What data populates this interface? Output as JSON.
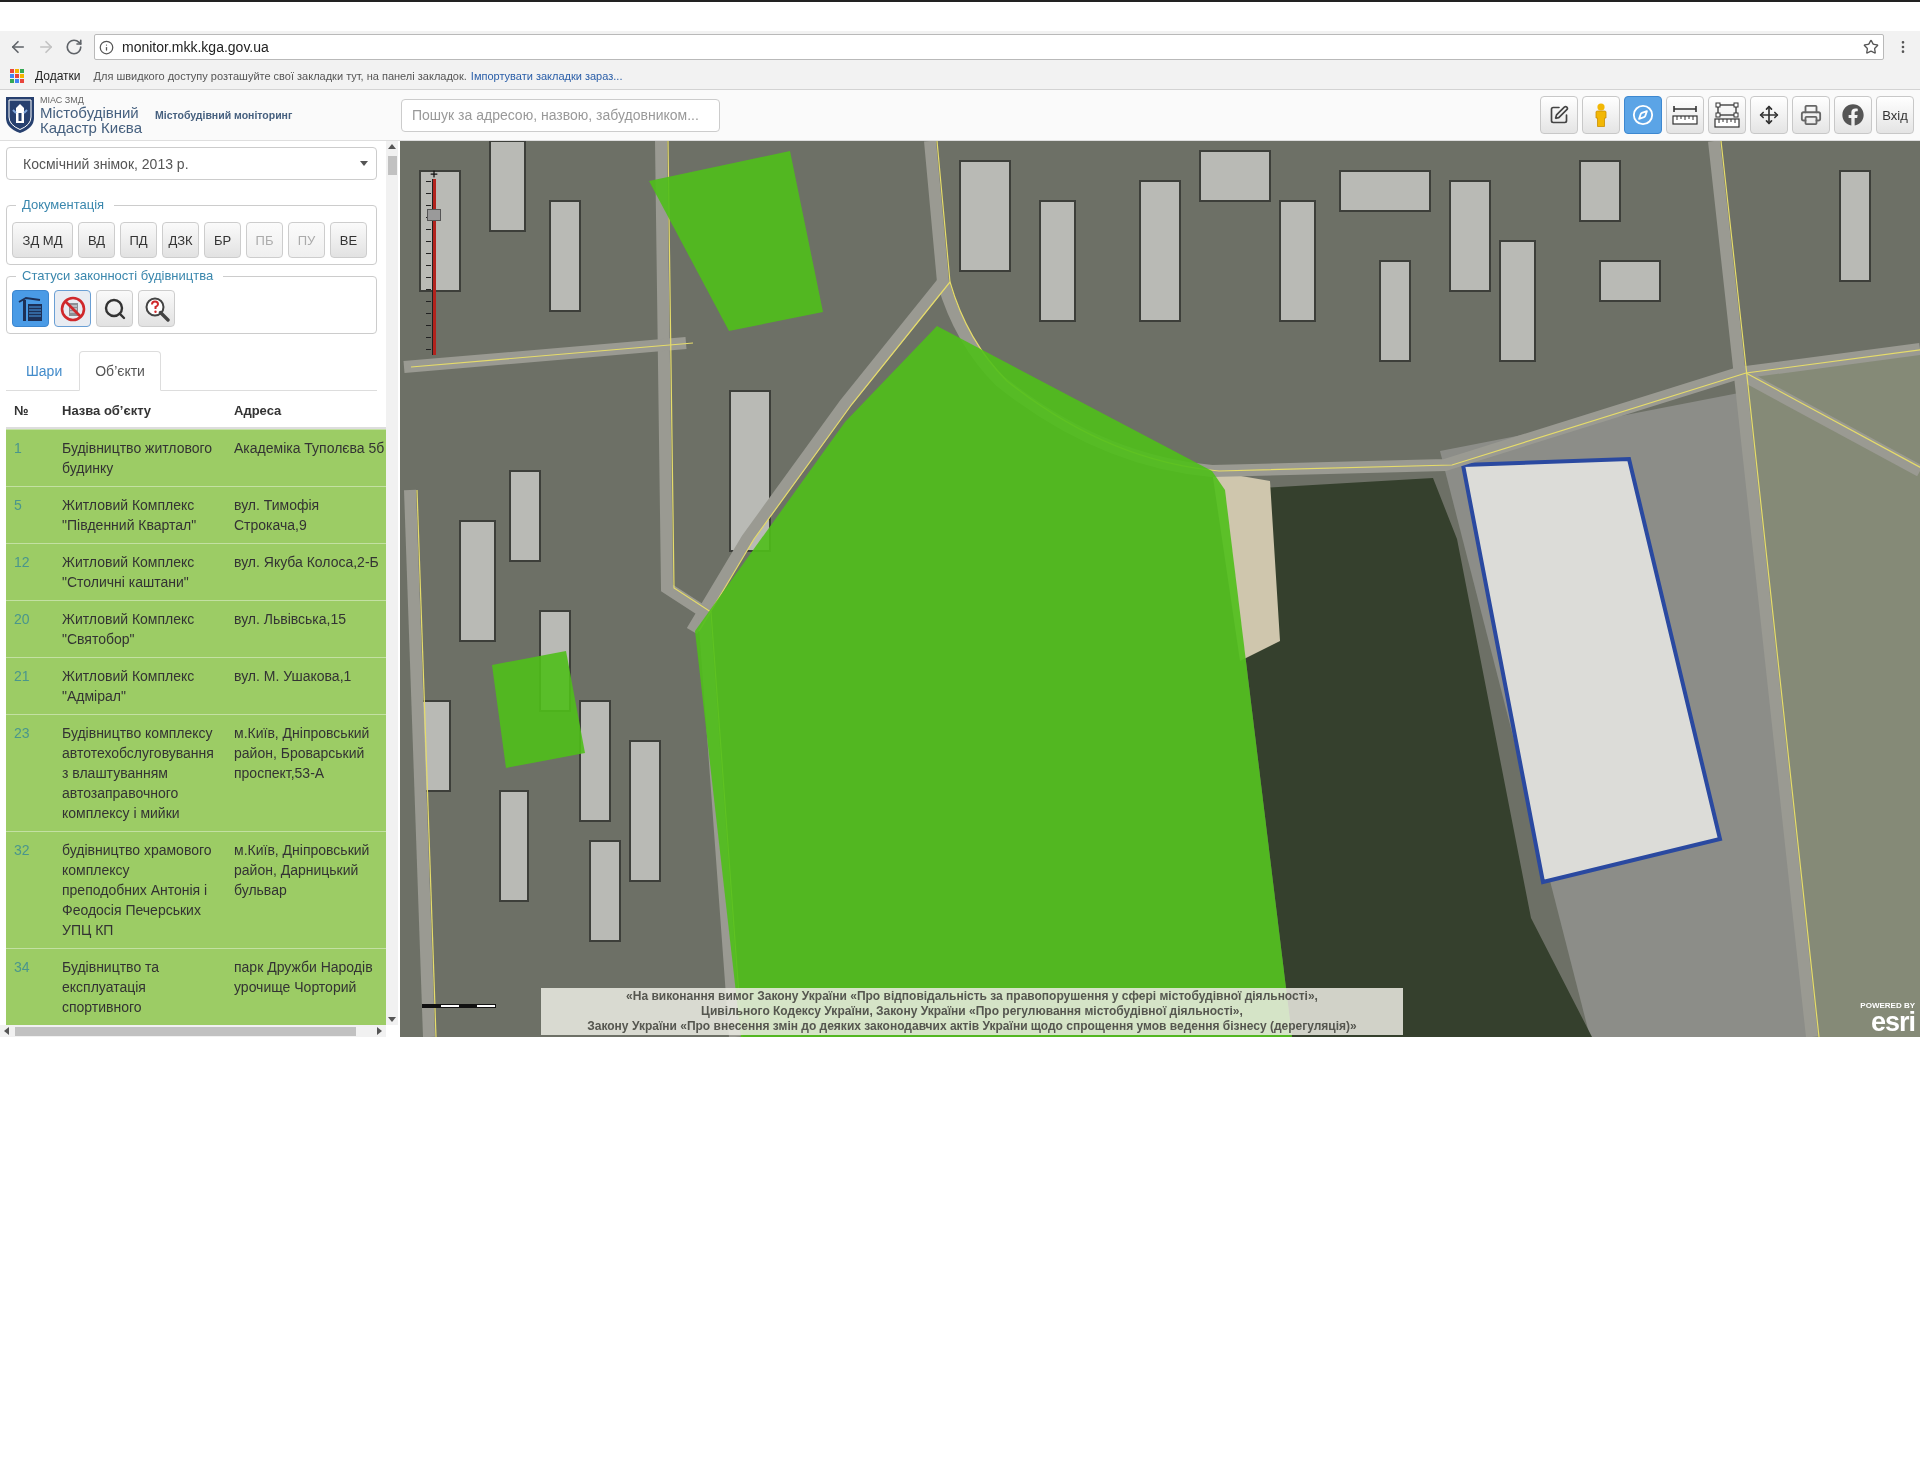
{
  "browser": {
    "nav": [
      {
        "kind": "back",
        "disabled": false
      },
      {
        "kind": "forward",
        "disabled": true
      },
      {
        "kind": "reload",
        "disabled": false
      }
    ],
    "url": "monitor.mkk.kga.gov.ua",
    "bookmarks": {
      "apps_label": "Додатки",
      "hint": "Для швидкого доступу розташуйте свої закладки тут, на панелі закладок.",
      "import_link": "Імпортувати закладки зараз..."
    }
  },
  "header": {
    "logo": {
      "caption": "МІАС ЗМД",
      "title_line_1": "Містобудівний",
      "title_line_2": "Кадастр Києва"
    },
    "subtitle": "Містобудівний моніторинг",
    "search": {
      "placeholder": "Пошук за адресою, назвою, забудовником..."
    },
    "toolbar": [
      {
        "kind": "edit",
        "selected": false
      },
      {
        "kind": "pegman",
        "selected": false
      },
      {
        "kind": "compass",
        "selected": true
      },
      {
        "kind": "ruler",
        "selected": false
      },
      {
        "kind": "area",
        "selected": false
      },
      {
        "kind": "move",
        "selected": false
      },
      {
        "kind": "print",
        "selected": false
      },
      {
        "kind": "facebook",
        "selected": false
      },
      {
        "kind": "login",
        "label": "Вхід",
        "selected": false
      }
    ]
  },
  "sidebar": {
    "basemap_select": {
      "value": "Космічний знімок, 2013 р."
    },
    "documentation": {
      "legend": "Документація",
      "buttons": [
        {
          "label": "ЗД МД",
          "disabled": false
        },
        {
          "label": "ВД",
          "disabled": false
        },
        {
          "label": "ПД",
          "disabled": false
        },
        {
          "label": "ДЗК",
          "disabled": false
        },
        {
          "label": "БР",
          "disabled": false
        },
        {
          "label": "ПБ",
          "disabled": true
        },
        {
          "label": "ПУ",
          "disabled": true
        },
        {
          "label": "ВЕ",
          "disabled": false
        }
      ]
    },
    "legality_statuses": {
      "legend": "Статуси законності будівництва",
      "buttons": [
        {
          "kind": "building",
          "selected": true,
          "focused": false
        },
        {
          "kind": "no-building",
          "selected": false,
          "focused": true
        },
        {
          "kind": "search",
          "selected": false,
          "focused": false
        },
        {
          "kind": "search-question",
          "selected": false,
          "focused": false
        }
      ]
    },
    "tabs": [
      {
        "label": "Шари",
        "selected": false
      },
      {
        "label": "Об’єкти",
        "selected": true
      }
    ],
    "table": {
      "columns": [
        "№",
        "Назва об’єкту",
        "Адреса"
      ],
      "rows": [
        {
          "number": "1",
          "name": "Будівництво житлового будинку",
          "address": "Академіка Туполєва 5б"
        },
        {
          "number": "5",
          "name": "Житловий Комплекс \"Південний Квартал\"",
          "address": "вул. Тимофія Строкача,9"
        },
        {
          "number": "12",
          "name": "Житловий Комплекс \"Столичні каштани\"",
          "address": "вул. Якуба Колоса,2-Б"
        },
        {
          "number": "20",
          "name": "Житловий Комплекс \"Святобор\"",
          "address": "вул. Львівська,15"
        },
        {
          "number": "21",
          "name": "Житловий Комплекс \"Адмірал\"",
          "address": "вул. М. Ушакова,1"
        },
        {
          "number": "23",
          "name": "Будівництво комплексу автотехобслуговування з влаштуванням автозаправочного комплексу і мийки",
          "address": "м.Київ, Дніпровський район, Броварський проспект,53-А"
        },
        {
          "number": "32",
          "name": "будівництво храмового комплексу преподобних Антонія і Феодосія Печерських УПЦ КП",
          "address": "м.Київ, Дніпровський район, Дарницький бульвар"
        },
        {
          "number": "34",
          "name": "Будівництво та експлуатація спортивного",
          "address": "парк Дружби Народів урочище Чорторий"
        }
      ]
    }
  },
  "map": {
    "zoom_slider": {
      "level": 0.82
    },
    "notice": "«На виконання вимог Закону України «Про відповідальність за правопорушення у сфері містобудівної діяльності»,\nЦивільного Кодексу України, Закону України «Про регулювання містобудівної діяльності»,\nЗакону України «Про внесення змін до деяких законодавчих актів України щодо спрощення умов ведення бізнесу (дерегуляція)»",
    "attribution": {
      "caption": "POWERED BY",
      "logo": "esri"
    }
  }
}
